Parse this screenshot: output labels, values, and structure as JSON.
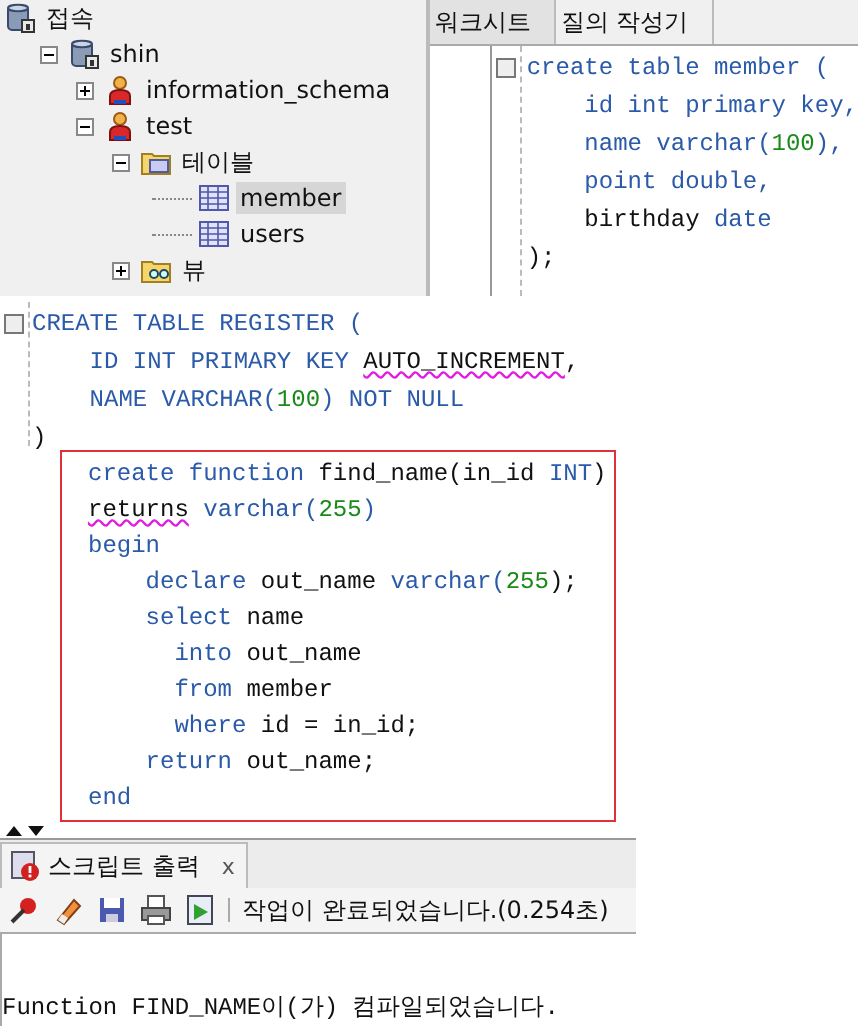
{
  "tree": [
    {
      "label": "접속",
      "kind": "connections",
      "selected": false,
      "children": [
        {
          "label": "shin",
          "kind": "database",
          "expanded": true,
          "selected": false,
          "children": [
            {
              "label": "information_schema",
              "kind": "user",
              "expanded": false,
              "selected": false
            },
            {
              "label": "test",
              "kind": "user",
              "expanded": true,
              "selected": false,
              "children": [
                {
                  "label": "테이블",
                  "kind": "table-folder",
                  "expanded": true,
                  "selected": false,
                  "children": [
                    {
                      "label": "member",
                      "kind": "table",
                      "selected": true
                    },
                    {
                      "label": "users",
                      "kind": "table",
                      "selected": false
                    }
                  ]
                },
                {
                  "label": "뷰",
                  "kind": "view-folder",
                  "expanded": false,
                  "selected": false
                }
              ]
            }
          ]
        }
      ]
    }
  ],
  "worksheet": {
    "tabs": [
      {
        "label": "워크시트",
        "selected": true
      },
      {
        "label": "질의 작성기",
        "selected": false
      }
    ],
    "code": [
      [
        {
          "t": "create table member (",
          "kind": "keyword"
        }
      ],
      [
        {
          "t": "    id int primary key,",
          "kind": "keyword"
        }
      ],
      [
        {
          "t": "    name varchar(",
          "kind": "keyword"
        },
        {
          "t": "100",
          "kind": "number"
        },
        {
          "t": "),",
          "kind": "keyword"
        }
      ],
      [
        {
          "t": "    point double,",
          "kind": "keyword"
        }
      ],
      [
        {
          "t": "    birthday ",
          "kind": "plain"
        },
        {
          "t": "date",
          "kind": "keyword"
        }
      ],
      [
        {
          "t": ");",
          "kind": "plain"
        }
      ]
    ]
  },
  "register_code": [
    [
      {
        "t": "CREATE TABLE REGISTER (",
        "kind": "keyword"
      }
    ],
    [
      {
        "t": "    ID INT PRIMARY KEY ",
        "kind": "keyword"
      },
      {
        "t": "AUTO_INCREMENT",
        "kind": "error"
      },
      {
        "t": ",",
        "kind": "plain"
      }
    ],
    [
      {
        "t": "    NAME VARCHAR(",
        "kind": "keyword"
      },
      {
        "t": "100",
        "kind": "number"
      },
      {
        "t": ") NOT NULL",
        "kind": "keyword"
      }
    ],
    [
      {
        "t": ")",
        "kind": "plain"
      }
    ]
  ],
  "function_code": [
    [
      {
        "t": "create function ",
        "kind": "keyword"
      },
      {
        "t": "find_name(in_id ",
        "kind": "plain"
      },
      {
        "t": "INT",
        "kind": "keyword"
      },
      {
        "t": ")",
        "kind": "plain"
      }
    ],
    [
      {
        "t": "returns",
        "kind": "error"
      },
      {
        "t": " varchar(",
        "kind": "keyword"
      },
      {
        "t": "255",
        "kind": "number"
      },
      {
        "t": ")",
        "kind": "keyword"
      }
    ],
    [
      {
        "t": "begin",
        "kind": "keyword"
      }
    ],
    [
      {
        "t": "    declare ",
        "kind": "keyword"
      },
      {
        "t": "out_name ",
        "kind": "plain"
      },
      {
        "t": "varchar(",
        "kind": "keyword"
      },
      {
        "t": "255",
        "kind": "number"
      },
      {
        "t": ");",
        "kind": "plain"
      }
    ],
    [
      {
        "t": "    select ",
        "kind": "keyword"
      },
      {
        "t": "name",
        "kind": "plain"
      }
    ],
    [
      {
        "t": "      into ",
        "kind": "keyword"
      },
      {
        "t": "out_name",
        "kind": "plain"
      }
    ],
    [
      {
        "t": "      from ",
        "kind": "keyword"
      },
      {
        "t": "member",
        "kind": "plain"
      }
    ],
    [
      {
        "t": "      where ",
        "kind": "keyword"
      },
      {
        "t": "id = in_id;",
        "kind": "plain"
      }
    ],
    [
      {
        "t": "    return ",
        "kind": "keyword"
      },
      {
        "t": "out_name;",
        "kind": "plain"
      }
    ],
    [
      {
        "t": "end",
        "kind": "keyword"
      }
    ]
  ],
  "output": {
    "tab": {
      "label": "스크립트 출력",
      "close": "x"
    },
    "status": "작업이 완료되었습니다.(0.254초)",
    "message": "Function FIND_NAME이(가) 컴파일되었습니다."
  }
}
